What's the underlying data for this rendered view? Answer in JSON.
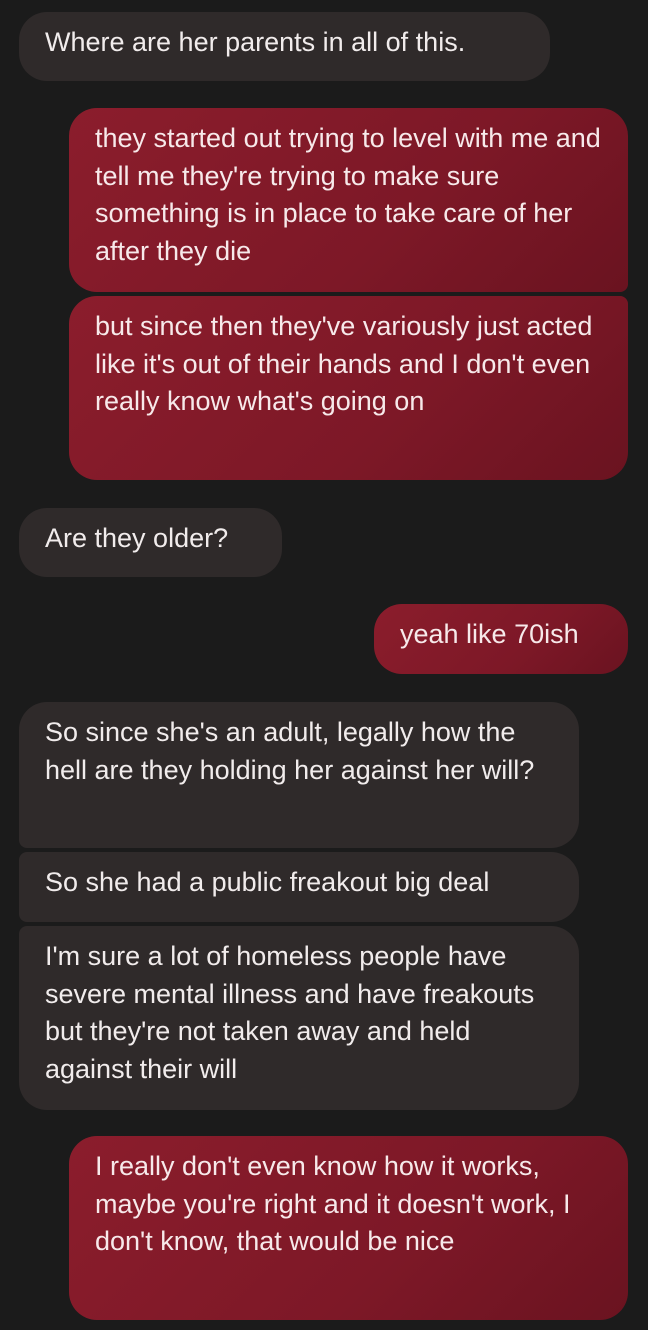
{
  "messages": [
    {
      "sender": "them",
      "text": "Where are her parents in all of this."
    },
    {
      "sender": "me",
      "text": "they started out trying to level with me and tell me they're trying to make sure something is in place to take care of her after they die"
    },
    {
      "sender": "me",
      "text": "but since then they've variously just acted like it's out of their hands and I don't even really know what's going on"
    },
    {
      "sender": "them",
      "text": "Are they older?"
    },
    {
      "sender": "me",
      "text": "yeah like 70ish"
    },
    {
      "sender": "them",
      "text": "So since she's an adult, legally how the hell are they holding her against her will?"
    },
    {
      "sender": "them",
      "text": "So she had a public freakout big deal"
    },
    {
      "sender": "them",
      "text": "I'm sure a lot of homeless people have severe mental illness and have freakouts but they're not taken away and held against their will"
    },
    {
      "sender": "me",
      "text": "I really don't even know how it works, maybe you're right and it doesn't work, I don't know, that would be nice"
    }
  ],
  "colors": {
    "background": "#1b1b1b",
    "incoming_bubble": "#2f2a2a",
    "outgoing_bubble": "#7d1827",
    "text": "#f1ecec"
  }
}
